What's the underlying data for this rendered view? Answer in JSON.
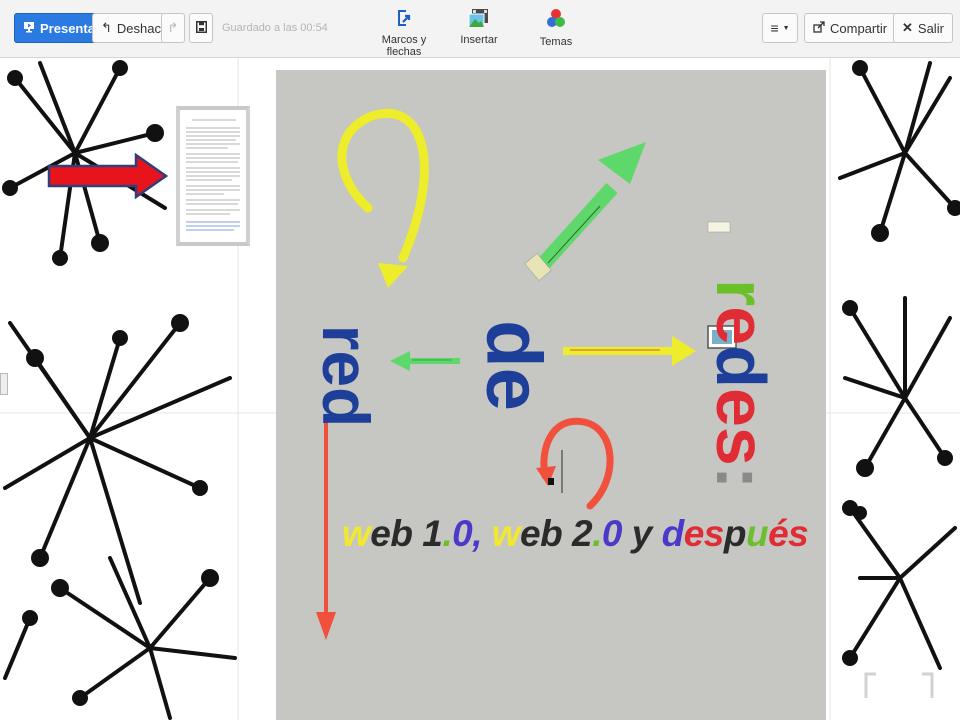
{
  "toolbar": {
    "present_label": "Presentar",
    "undo_label": "Deshacer",
    "saved_status": "Guardado a las 00:54",
    "tools": [
      {
        "label": "Marcos y flechas",
        "icon": "frames-arrows-icon"
      },
      {
        "label": "Insertar",
        "icon": "insert-image-icon"
      },
      {
        "label": "Temas",
        "icon": "themes-icon"
      }
    ],
    "share_label": "Compartir",
    "exit_label": "Salir"
  },
  "canvas": {
    "words": {
      "red": "red",
      "de": "de",
      "redes": "redes:"
    },
    "subtitle": [
      {
        "t": "w",
        "c": "#f2e830"
      },
      {
        "t": "eb",
        "c": "#2b2b2b"
      },
      {
        "t": " 1",
        "c": "#2b2b2b"
      },
      {
        "t": ".",
        "c": "#6bbf2e"
      },
      {
        "t": "0",
        "c": "#4b3ac9"
      },
      {
        "t": ", ",
        "c": "#4b3ac9"
      },
      {
        "t": "w",
        "c": "#f2e830"
      },
      {
        "t": "eb",
        "c": "#2b2b2b"
      },
      {
        "t": " 2",
        "c": "#2b2b2b"
      },
      {
        "t": ".",
        "c": "#6bbf2e"
      },
      {
        "t": "0",
        "c": "#4b3ac9"
      },
      {
        "t": " y ",
        "c": "#2b2b2b"
      },
      {
        "t": "d",
        "c": "#4b3ac9"
      },
      {
        "t": "e",
        "c": "#e02c34"
      },
      {
        "t": "s",
        "c": "#e02c34"
      },
      {
        "t": "p",
        "c": "#2b2b2b"
      },
      {
        "t": "u",
        "c": "#6bbf2e"
      },
      {
        "t": "é",
        "c": "#e02c34"
      },
      {
        "t": "s",
        "c": "#e02c34"
      }
    ],
    "colors": {
      "stage": "#c6c6c2",
      "blue": "#1e3f99",
      "green": "#6bc02a",
      "red": "#e02c34",
      "yellow": "#eded2c",
      "arrow_green": "#5ed86a",
      "arrow_red": "#f0503c"
    }
  }
}
